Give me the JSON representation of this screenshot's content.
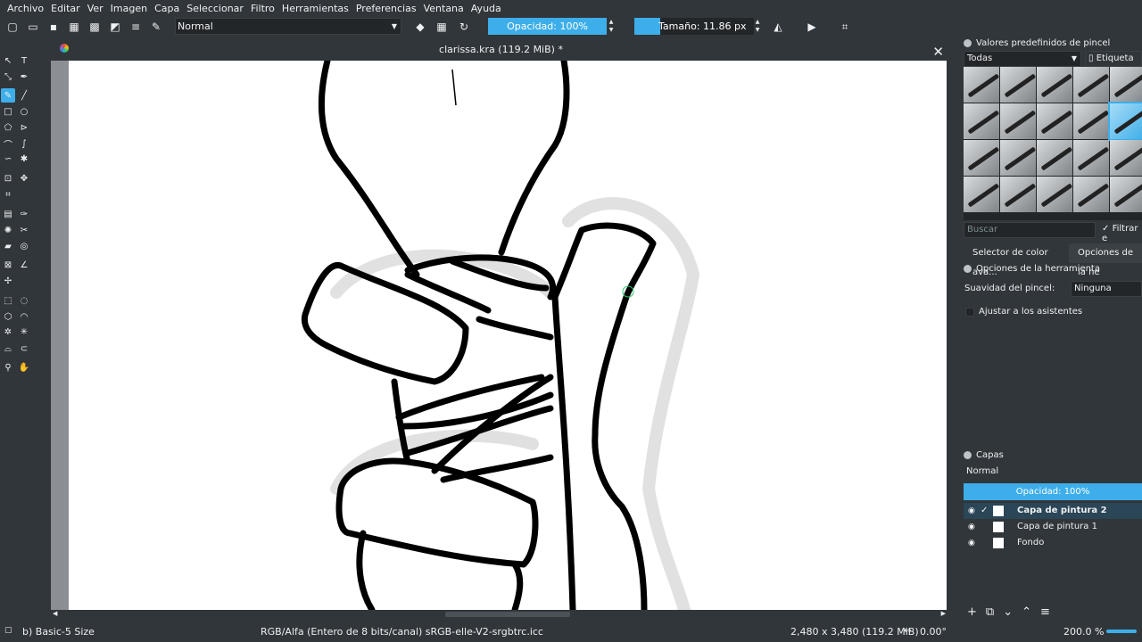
{
  "menu": [
    "Archivo",
    "Editar",
    "Ver",
    "Imagen",
    "Capa",
    "Seleccionar",
    "Filtro",
    "Herramientas",
    "Preferencias",
    "Ventana",
    "Ayuda"
  ],
  "toolbar": {
    "blend_mode": "Normal",
    "opacity_label": "Opacidad: 100%",
    "size_label": "Tamaño: 11.86 px",
    "size_fraction": 0.22
  },
  "document": {
    "title": "clarissa.kra (119.2 MiB) *"
  },
  "brush_presets": {
    "title": "Valores predefinidos de pincel",
    "filter_value": "Todas",
    "tag_label": "Etiqueta",
    "search_placeholder": "Buscar",
    "filter_check_label": "Filtrar e",
    "selected_index": 9,
    "count": 20
  },
  "panel_tabs": [
    "Selector de color ava...",
    "Opciones de la he"
  ],
  "tool_options": {
    "title": "Opciones de la herramienta",
    "smoothing_label": "Suavidad del pincel:",
    "smoothing_value": "Ninguna",
    "assistants_label": "Ajustar a los asistentes"
  },
  "layers": {
    "title": "Capas",
    "blend_mode": "Normal",
    "opacity_label": "Opacidad:  100%",
    "items": [
      {
        "name": "Capa de pintura 2",
        "selected": true
      },
      {
        "name": "Capa de pintura 1",
        "selected": false
      },
      {
        "name": "Fondo",
        "selected": false
      }
    ]
  },
  "status": {
    "brush": "b) Basic-5 Size",
    "color_space": "RGB/Alfa (Entero de 8 bits/canal)  sRGB-elle-V2-srgbtrc.icc",
    "dimensions": "2,480 x 3,480 (119.2 MiB)",
    "rotation": "0.00°",
    "zoom": "200.0 %"
  },
  "colors": {
    "accent": "#3daee9",
    "background": "#31363b",
    "canvas": "#ffffff"
  }
}
